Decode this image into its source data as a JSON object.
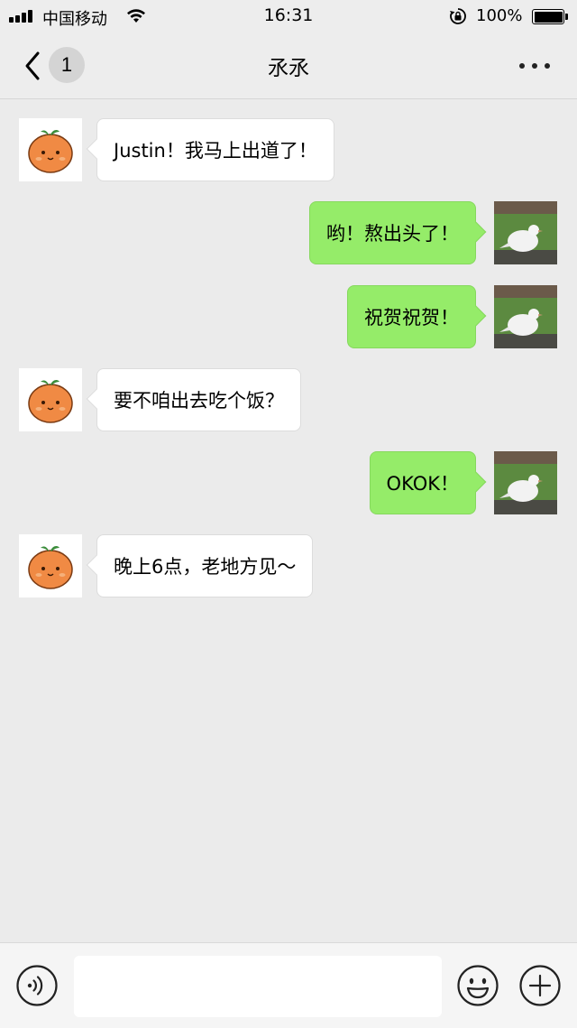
{
  "status_bar": {
    "carrier": "中国移动",
    "time": "16:31",
    "battery_percent": "100%",
    "icons": [
      "signal-icon",
      "wifi-icon",
      "rotation-lock-icon",
      "battery-icon"
    ]
  },
  "nav": {
    "back_icon": "chevron-left-icon",
    "unread_count": "1",
    "title": "氶氶",
    "more_icon": "more-dots-icon"
  },
  "messages": [
    {
      "side": "in",
      "text": "Justin！我马上出道了！",
      "avatar": "orange-avatar"
    },
    {
      "side": "out",
      "text": "哟！熬出头了！",
      "avatar": "dove-avatar"
    },
    {
      "side": "out",
      "text": "祝贺祝贺！",
      "avatar": "dove-avatar"
    },
    {
      "side": "in",
      "text": "要不咱出去吃个饭？",
      "avatar": "orange-avatar"
    },
    {
      "side": "out",
      "text": "OKOK！",
      "avatar": "dove-avatar"
    },
    {
      "side": "in",
      "text": "晚上6点，老地方见～",
      "avatar": "orange-avatar"
    }
  ],
  "input_bar": {
    "voice_icon": "voice-icon",
    "text_value": "",
    "emoji_icon": "emoji-icon",
    "plus_icon": "plus-icon"
  },
  "colors": {
    "background": "#ebebeb",
    "outgoing_bubble": "#95ec69",
    "incoming_bubble": "#ffffff",
    "bar": "#ededed"
  }
}
